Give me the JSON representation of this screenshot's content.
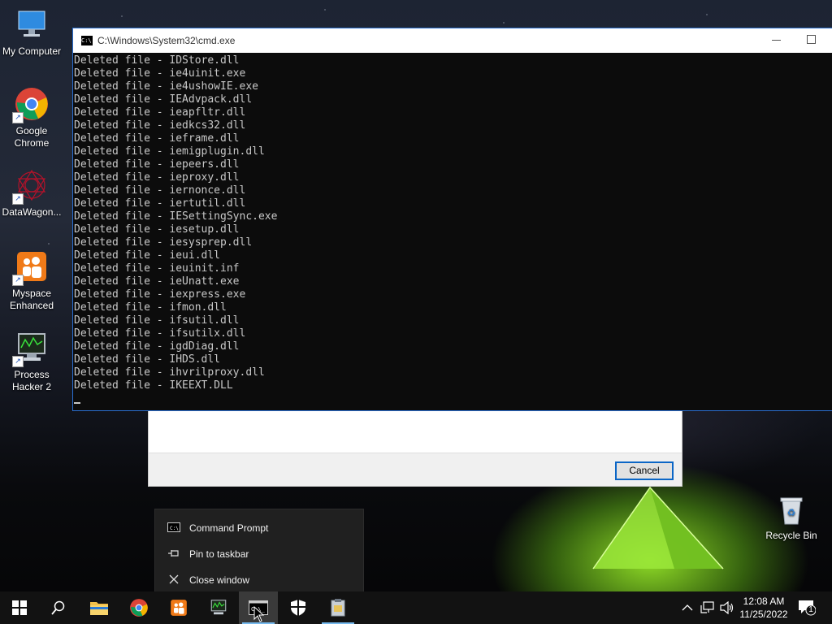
{
  "desktop": {
    "icons": [
      {
        "label": "My Computer"
      },
      {
        "label": "Google Chrome"
      },
      {
        "label": "DataWagon..."
      },
      {
        "label": "Myspace Enhanced"
      },
      {
        "label": "Process Hacker 2"
      }
    ],
    "recycle_bin": "Recycle Bin"
  },
  "cmd_window": {
    "title": "C:\\Windows\\System32\\cmd.exe",
    "lines": [
      "Deleted file - IDStore.dll",
      "Deleted file - ie4uinit.exe",
      "Deleted file - ie4ushowIE.exe",
      "Deleted file - IEAdvpack.dll",
      "Deleted file - ieapfltr.dll",
      "Deleted file - iedkcs32.dll",
      "Deleted file - ieframe.dll",
      "Deleted file - iemigplugin.dll",
      "Deleted file - iepeers.dll",
      "Deleted file - ieproxy.dll",
      "Deleted file - iernonce.dll",
      "Deleted file - iertutil.dll",
      "Deleted file - IESettingSync.exe",
      "Deleted file - iesetup.dll",
      "Deleted file - iesysprep.dll",
      "Deleted file - ieui.dll",
      "Deleted file - ieuinit.inf",
      "Deleted file - ieUnatt.exe",
      "Deleted file - iexpress.exe",
      "Deleted file - ifmon.dll",
      "Deleted file - ifsutil.dll",
      "Deleted file - ifsutilx.dll",
      "Deleted file - igdDiag.dll",
      "Deleted file - IHDS.dll",
      "Deleted file - ihvrilproxy.dll",
      "Deleted file - IKEEXT.DLL"
    ]
  },
  "dialog": {
    "cancel_label": "Cancel"
  },
  "jump_list": {
    "items": [
      {
        "label": "Command Prompt",
        "icon": "cmd-icon"
      },
      {
        "label": "Pin to taskbar",
        "icon": "pin-icon"
      },
      {
        "label": "Close window",
        "icon": "close-icon"
      }
    ]
  },
  "taskbar": {
    "apps": [
      "start",
      "search",
      "file-explorer",
      "chrome",
      "myspace-enhanced",
      "process-hacker",
      "cmd",
      "security",
      "archive"
    ],
    "active_app": "cmd",
    "clock_time": "12:08 AM",
    "clock_date": "11/25/2022",
    "notification_count": "1"
  },
  "colors": {
    "accent": "#0b66c6",
    "cmd_background": "#0c0c0c",
    "cmd_text": "#c8c8c8",
    "taskbar": "#121212"
  }
}
